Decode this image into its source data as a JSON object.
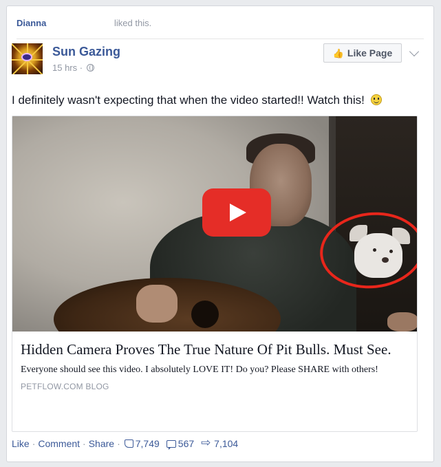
{
  "story": {
    "actor": "Dianna",
    "action": "liked this."
  },
  "post": {
    "page_name": "Sun Gazing",
    "time": "15 hrs",
    "meta_sep": "·",
    "like_page_label": "Like Page",
    "text": "I definitely wasn't expecting that when the video started!! Watch this!"
  },
  "attachment": {
    "title": "Hidden Camera Proves The True Nature Of Pit Bulls. Must See.",
    "description": "Everyone should see this video. I absolutely LOVE IT! Do you? Please SHARE with others!",
    "source": "PETFLOW.COM BLOG"
  },
  "footer": {
    "like": "Like",
    "comment": "Comment",
    "share": "Share",
    "sep": "·",
    "likes_count": "7,749",
    "comments_count": "567",
    "shares_count": "7,104"
  },
  "colors": {
    "link_blue": "#3b5998",
    "muted_gray": "#9197a3",
    "play_red": "#e52d27",
    "annotation_red": "#e8261b"
  },
  "icons": [
    "globe-icon",
    "thumb-icon",
    "chevron-down-icon",
    "smiley-icon",
    "play-icon",
    "like-outline-icon",
    "comment-icon",
    "share-icon"
  ]
}
